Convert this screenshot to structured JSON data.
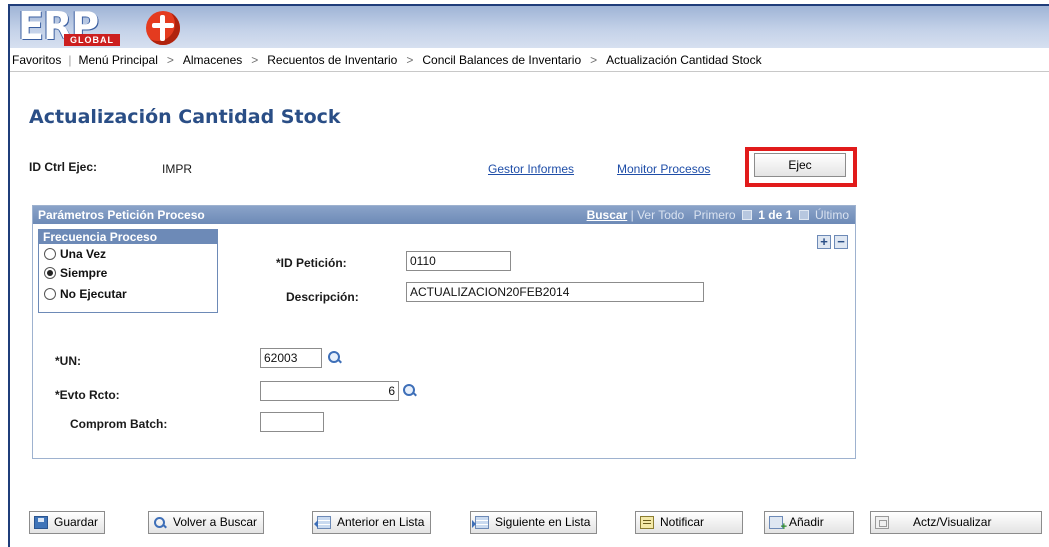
{
  "header": {
    "logo_text": "ERP",
    "logo_sub": "GLOBAL"
  },
  "breadcrumb": {
    "favorites": "Favoritos",
    "items": [
      "Menú Principal",
      "Almacenes",
      "Recuentos de Inventario",
      "Concil Balances de Inventario",
      "Actualización Cantidad Stock"
    ],
    "separator": ">"
  },
  "page": {
    "title": "Actualización Cantidad Stock",
    "run_control_label": "ID Ctrl Ejec:",
    "run_control_value": "IMPR",
    "report_manager_link": "Gestor Informes",
    "process_monitor_link": "Monitor Procesos",
    "run_button": "Ejec",
    "highlight_color": "#e11b1b"
  },
  "params": {
    "title": "Parámetros Petición Proceso",
    "nav": {
      "find": "Buscar",
      "divider": "|",
      "view_all": "Ver Todo",
      "first": "Primero",
      "count": "1 de 1",
      "last": "Último"
    },
    "frequency": {
      "title": "Frecuencia Proceso",
      "options": [
        "Una Vez",
        "Siempre",
        "No Ejecutar"
      ],
      "selected": "Siempre"
    },
    "request_id_label": "*ID Petición:",
    "request_id_value": "0110",
    "description_label": "Descripción:",
    "description_value": "ACTUALIZACION20FEB2014",
    "add_row": "+",
    "delete_row": "−",
    "un_label": "*UN:",
    "un_value": "62003",
    "count_event_label": "*Evto Rcto:",
    "count_event_value": "6",
    "commit_batch_label": "Comprom Batch:",
    "commit_batch_value": ""
  },
  "toolbar": {
    "save": "Guardar",
    "return_search": "Volver a Buscar",
    "prev_in_list": "Anterior en Lista",
    "next_in_list": "Siguiente en Lista",
    "notify": "Notificar",
    "add": "Añadir",
    "update_display": "Actz/Visualizar"
  },
  "colors": {
    "title_blue": "#2a4e86",
    "group_header": "#6d8ab7",
    "link_blue": "#1f4ea8"
  }
}
